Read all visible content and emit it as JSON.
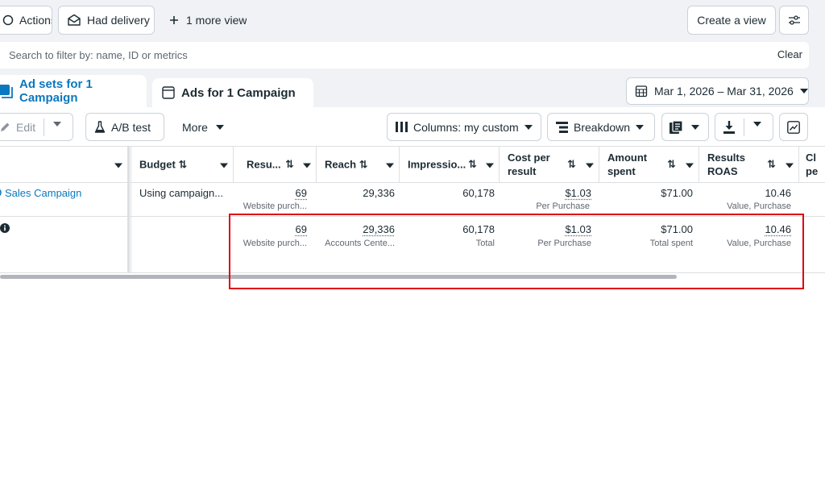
{
  "filters": {
    "actions_label": "Actions",
    "delivery_label": "Had delivery",
    "more_view_label": "1 more view",
    "create_view_label": "Create a view"
  },
  "search": {
    "placeholder": "Search to filter by: name, ID or metrics",
    "clear_label": "Clear"
  },
  "tabs": [
    {
      "label": "Ad sets for 1 Campaign",
      "active": true
    },
    {
      "label": "Ads for 1 Campaign",
      "active": false
    }
  ],
  "date_range": "Mar 1, 2026 – Mar 31, 2026",
  "toolbar": {
    "edit_label": "Edit",
    "ab_test_label": "A/B test",
    "more_label": "More",
    "columns_label": "Columns: my custom",
    "breakdown_label": "Breakdown"
  },
  "table": {
    "headers": {
      "budget": "Budget",
      "results": "Resu...",
      "reach": "Reach",
      "impressions": "Impressio...",
      "cost_per_result_1": "Cost per",
      "cost_per_result_2": "result",
      "amount_spent_1": "Amount",
      "amount_spent_2": "spent",
      "roas_1": "Results",
      "roas_2": "ROAS",
      "next_1": "Cl",
      "next_2": "pe"
    },
    "rows": [
      {
        "name": "Sales Campaign",
        "budget": "Using campaign...",
        "results": "69",
        "results_sub": "Website purch...",
        "reach": "29,336",
        "impressions": "60,178",
        "cost_per_result": "$1.03",
        "cost_per_result_sub": "Per Purchase",
        "amount_spent": "$71.00",
        "roas": "10.46",
        "roas_sub": "Value, Purchase"
      }
    ],
    "totals": {
      "results": "69",
      "results_sub": "Website purch...",
      "reach": "29,336",
      "reach_sub": "Accounts Cente...",
      "impressions": "60,178",
      "impressions_sub": "Total",
      "cost_per_result": "$1.03",
      "cost_per_result_sub": "Per Purchase",
      "amount_spent": "$71.00",
      "amount_spent_sub": "Total spent",
      "roas": "10.46",
      "roas_sub": "Value, Purchase"
    }
  },
  "colors": {
    "accent": "#0a78be",
    "highlight": "#e0000f",
    "background": "#f0f2f5"
  }
}
